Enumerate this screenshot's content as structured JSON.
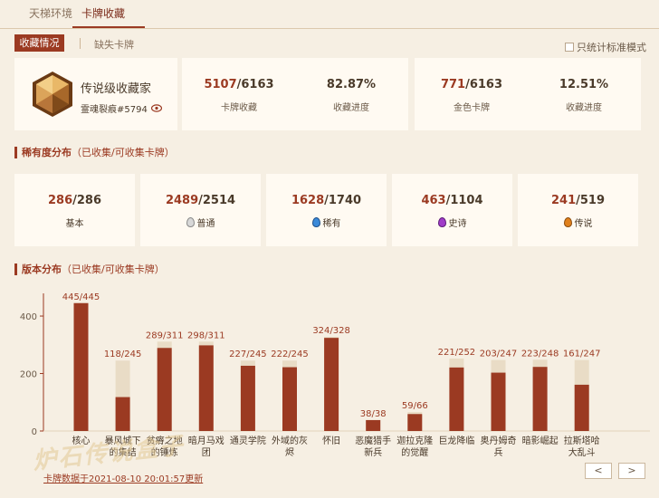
{
  "top_tabs": [
    "天梯环境",
    "卡牌收藏"
  ],
  "sub_tabs": {
    "active": "收藏情况",
    "other": "缺失卡牌"
  },
  "standard_mode_label": "只统计标准模式",
  "profile": {
    "title": "传说级收藏家",
    "user": "霊魂裂痕#5794"
  },
  "stats": [
    {
      "owned": "5107",
      "total": "/6163",
      "label": "卡牌收藏"
    },
    {
      "value": "82.87%",
      "label": "收藏进度"
    },
    {
      "owned": "771",
      "total": "/6163",
      "label": "金色卡牌"
    },
    {
      "value": "12.51%",
      "label": "收藏进度"
    }
  ],
  "rarity_section": {
    "title": "稀有度分布",
    "note": "（已收集/可收集卡牌）"
  },
  "rarity": [
    {
      "owned": "286",
      "total": "/286",
      "label": "基本",
      "color": ""
    },
    {
      "owned": "2489",
      "total": "/2514",
      "label": "普通",
      "color": "#d8d8d8"
    },
    {
      "owned": "1628",
      "total": "/1740",
      "label": "稀有",
      "color": "#3b8ad9"
    },
    {
      "owned": "463",
      "total": "/1104",
      "label": "史诗",
      "color": "#a03cc8"
    },
    {
      "owned": "241",
      "total": "/519",
      "label": "传说",
      "color": "#e0801c"
    }
  ],
  "version_section": {
    "title": "版本分布",
    "note": "（已收集/可收集卡牌）"
  },
  "chart_data": {
    "type": "bar",
    "ylim": [
      0,
      460
    ],
    "yticks": [
      0,
      200,
      400
    ],
    "categories": [
      [
        "核心"
      ],
      [
        "暴风城下",
        "的集结"
      ],
      [
        "贫瘠之地",
        "的锤炼"
      ],
      [
        "暗月马戏",
        "团"
      ],
      [
        "通灵学院"
      ],
      [
        "外域的灰",
        "烬"
      ],
      [
        "怀旧"
      ],
      [
        "恶魔猎手",
        "新兵"
      ],
      [
        "迦拉克隆",
        "的觉醒"
      ],
      [
        "巨龙降临"
      ],
      [
        "奥丹姆奇",
        "兵"
      ],
      [
        "暗影崛起"
      ],
      [
        "拉斯塔哈",
        "大乱斗"
      ]
    ],
    "collected": [
      445,
      118,
      289,
      298,
      227,
      222,
      324,
      38,
      59,
      221,
      203,
      223,
      161
    ],
    "totals": [
      445,
      245,
      311,
      311,
      245,
      245,
      328,
      38,
      66,
      252,
      247,
      248,
      247
    ],
    "labels": [
      "445/445",
      "118/245",
      "289/311",
      "298/311",
      "227/245",
      "222/245",
      "324/328",
      "38/38",
      "59/66",
      "221/252",
      "203/247",
      "223/248",
      "161/247"
    ]
  },
  "update_text": "卡牌数据于2021-08-10 20:01:57更新",
  "nav": {
    "prev": "<",
    "next": ">"
  },
  "watermark": "炉石传说盒子",
  "colors": {
    "accent": "#9b3a22",
    "bar_collected": "#9b3a22",
    "bar_total": "#e9dcc6"
  }
}
